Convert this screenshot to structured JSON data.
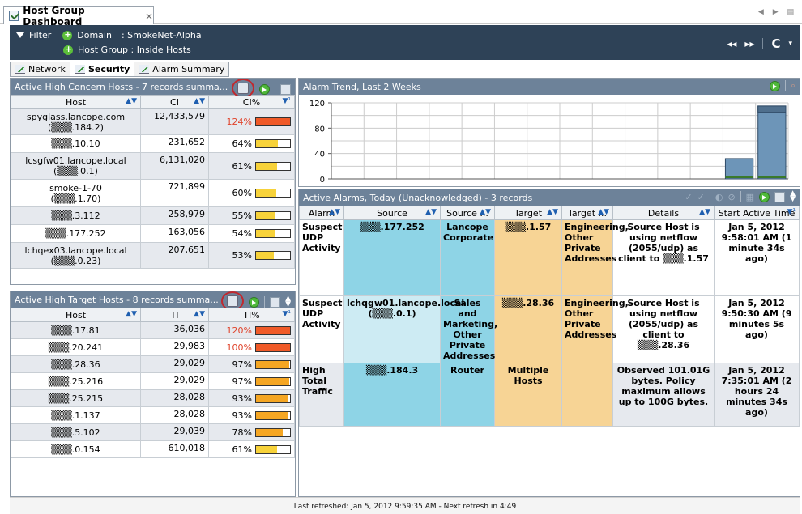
{
  "tab": {
    "title": "Host Group Dashboard",
    "close": "×"
  },
  "filter": {
    "label": "Filter",
    "domain_label": "Domain",
    "domain_value": ": SmokeNet-Alpha",
    "hostgroup_label": "Host Group : Inside Hosts"
  },
  "subtabs": [
    {
      "label": "Network"
    },
    {
      "label": "Security"
    },
    {
      "label": "Alarm Summary"
    }
  ],
  "concern": {
    "title": "Active High Concern Hosts - 7 records summa...",
    "columns": [
      "Host",
      "CI",
      "CI%"
    ],
    "rows": [
      {
        "host": "spyglass.lancope.com",
        "host2": "(▒▒▒.184.2)",
        "value": "12,433,579",
        "pct": "124%",
        "fill": 1.0,
        "color": "#f05a28"
      },
      {
        "host": "▒▒▒.10.10",
        "host2": "",
        "value": "231,652",
        "pct": "64%",
        "fill": 0.64,
        "color": "#f7d23a"
      },
      {
        "host": "lcsgfw01.lancope.local",
        "host2": "(▒▒▒.0.1)",
        "value": "6,131,020",
        "pct": "61%",
        "fill": 0.61,
        "color": "#f7d23a"
      },
      {
        "host": "smoke-1-70",
        "host2": "(▒▒▒.1.70)",
        "value": "721,899",
        "pct": "60%",
        "fill": 0.6,
        "color": "#f7d23a"
      },
      {
        "host": "▒▒▒.3.112",
        "host2": "",
        "value": "258,979",
        "pct": "55%",
        "fill": 0.55,
        "color": "#f7d23a"
      },
      {
        "host": "▒▒▒.177.252",
        "host2": "",
        "value": "163,056",
        "pct": "54%",
        "fill": 0.54,
        "color": "#f7d23a"
      },
      {
        "host": "lchqex03.lancope.local",
        "host2": "(▒▒▒.0.23)",
        "value": "207,651",
        "pct": "53%",
        "fill": 0.53,
        "color": "#f7d23a"
      }
    ]
  },
  "target": {
    "title": "Active High Target Hosts - 8 records summa...",
    "columns": [
      "Host",
      "TI",
      "TI%"
    ],
    "rows": [
      {
        "host": "▒▒▒.17.81",
        "value": "36,036",
        "pct": "120%",
        "fill": 1.0,
        "color": "#f05a28"
      },
      {
        "host": "▒▒▒.20.241",
        "value": "29,983",
        "pct": "100%",
        "fill": 1.0,
        "color": "#f05a28"
      },
      {
        "host": "▒▒▒.28.36",
        "value": "29,029",
        "pct": "97%",
        "fill": 0.97,
        "color": "#f5a623"
      },
      {
        "host": "▒▒▒.25.216",
        "value": "29,029",
        "pct": "97%",
        "fill": 0.97,
        "color": "#f5a623"
      },
      {
        "host": "▒▒▒.25.215",
        "value": "28,028",
        "pct": "93%",
        "fill": 0.93,
        "color": "#f5a623"
      },
      {
        "host": "▒▒▒.1.137",
        "value": "28,028",
        "pct": "93%",
        "fill": 0.93,
        "color": "#f5a623"
      },
      {
        "host": "▒▒▒.5.102",
        "value": "29,039",
        "pct": "78%",
        "fill": 0.78,
        "color": "#f5a623"
      },
      {
        "host": "▒▒▒.0.154",
        "value": "610,018",
        "pct": "61%",
        "fill": 0.61,
        "color": "#f7d23a"
      }
    ]
  },
  "trend": {
    "title": "Alarm Trend, Last 2 Weeks",
    "chart_data": {
      "type": "bar",
      "ylim": [
        0,
        120
      ],
      "yticks": [
        "120",
        "80",
        "40",
        "0"
      ],
      "values": [
        0,
        0,
        0,
        0,
        0,
        0,
        0,
        0,
        0,
        0,
        0,
        0,
        32,
        115
      ],
      "stacked_top": [
        0,
        0,
        0,
        0,
        0,
        0,
        0,
        0,
        0,
        0,
        0,
        0,
        0,
        10
      ]
    }
  },
  "alarms": {
    "title": "Active Alarms, Today (Unacknowledged) - 3 records",
    "columns": [
      "Alarm",
      "Source",
      "Source ...",
      "Target",
      "Target ...",
      "Details",
      "Start Active Time"
    ],
    "rows": [
      {
        "alarm": "Suspect UDP Activity",
        "source": "▒▒▒.177.252",
        "source_group": "Lancope Corporate",
        "target": "▒▒▒.1.57",
        "target_group": "Engineering, Other Private Addresses",
        "details": "Source Host is using netflow (2055/udp) as client to ▒▒▒.1.57",
        "time": "Jan 5, 2012 9:58:01 AM (1 minute 34s ago)"
      },
      {
        "alarm": "Suspect UDP Activity",
        "source": "lchqgw01.lancope.local (▒▒▒.0.1)",
        "source_group": "Sales and Marketing, Other Private Addresses",
        "target": "▒▒▒.28.36",
        "target_group": "Engineering, Other Private Addresses",
        "details": "Source Host is using netflow (2055/udp) as client to ▒▒▒.28.36",
        "time": "Jan 5, 2012 9:50:30 AM (9 minutes 5s ago)"
      },
      {
        "alarm": "High Total Traffic",
        "source": "▒▒▒.184.3",
        "source_group": "Router",
        "target": "Multiple Hosts",
        "target_group": "",
        "details": "Observed 101.01G bytes. Policy maximum allows up to 100G bytes.",
        "time": "Jan 5, 2012 7:35:01 AM (2 hours 24 minutes 34s ago)"
      }
    ]
  },
  "status": "Last refreshed: Jan 5, 2012 9:59:35 AM - Next refresh in 4:49"
}
